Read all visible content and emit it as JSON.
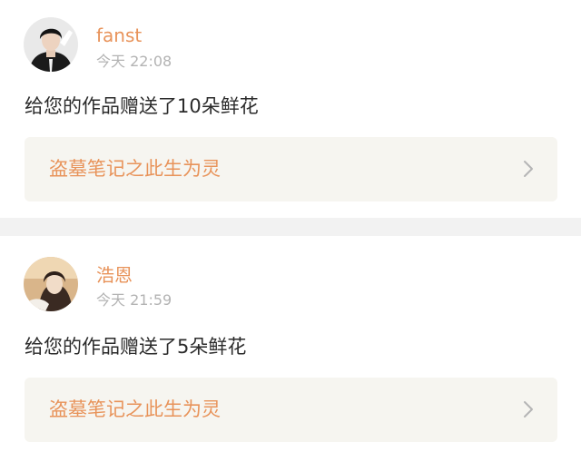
{
  "notifications": [
    {
      "username": "fanst",
      "time": "今天 22:08",
      "message": "给您的作品赠送了10朵鲜花",
      "work_title": "盗墓笔记之此生为灵",
      "chevron_icon": "chevron-right-icon"
    },
    {
      "username": "浩恩",
      "time": "今天 21:59",
      "message": "给您的作品赠送了5朵鲜花",
      "work_title": "盗墓笔记之此生为灵",
      "chevron_icon": "chevron-right-icon"
    }
  ],
  "colors": {
    "accent": "#e8935a",
    "timestamp": "#b3b3b3",
    "text": "#2b2b2b",
    "link_background": "#f6f5f0",
    "separator": "#f2f2f2"
  }
}
